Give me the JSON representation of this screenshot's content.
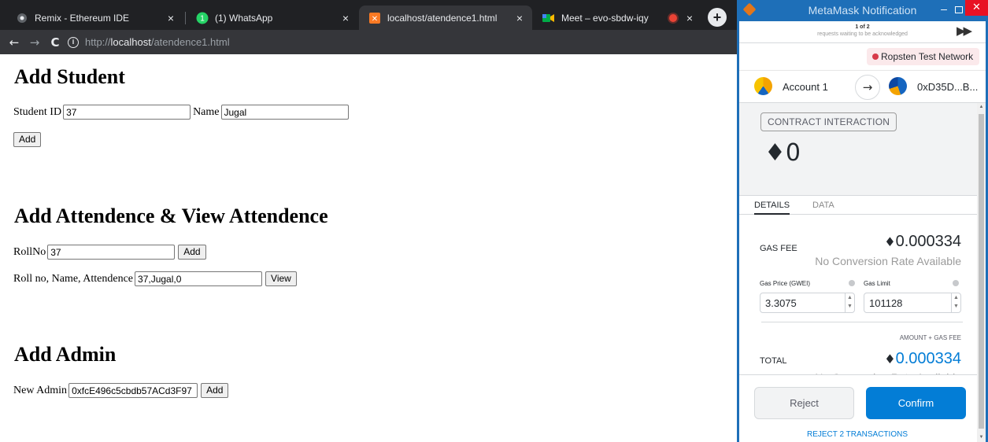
{
  "browser": {
    "tabs": [
      {
        "label": "Remix - Ethereum IDE",
        "close": "×"
      },
      {
        "label": "(1) WhatsApp",
        "close": "×"
      },
      {
        "label": "localhost/atendence1.html",
        "close": "×"
      },
      {
        "label": "Meet – evo-sbdw-iqy",
        "close": "×"
      }
    ],
    "whatsapp_badge": "1",
    "new_tab": "+",
    "url_scheme": "http://",
    "url_host": "localhost",
    "url_path": "/atendence1.html"
  },
  "page": {
    "add_student": {
      "heading": "Add Student",
      "id_label": "Student ID",
      "id_value": "37",
      "name_label": "Name",
      "name_value": "Jugal",
      "add_button": "Add"
    },
    "attendance": {
      "heading": "Add Attendence & View Attendence",
      "roll_label": "RollNo",
      "roll_value": "37",
      "add_button": "Add",
      "view_label": "Roll no, Name, Attendence",
      "view_value": "37,Jugal,0",
      "view_button": "View"
    },
    "admin": {
      "heading": "Add Admin",
      "label": "New Admin",
      "value": "0xfcE496c5cbdb57ACd3F97",
      "add_button": "Add"
    }
  },
  "metamask": {
    "window_title": "MetaMask Notification",
    "window_controls": {
      "minimize": "–",
      "close": "✕"
    },
    "queue_count": "1 of 2",
    "queue_text": "requests waiting to be acknowledged",
    "network": "Ropsten Test Network",
    "from_account": "Account 1",
    "to_account": "0xD35D...B...",
    "badge": "CONTRACT INTERACTION",
    "amount": "0",
    "tabs": [
      "DETAILS",
      "DATA"
    ],
    "gas_fee_label": "GAS FEE",
    "gas_fee_value": "0.000334",
    "no_conversion": "No Conversion Rate Available",
    "gas_price_label": "Gas Price (GWEI)",
    "gas_limit_label": "Gas Limit",
    "gas_price_value": "3.3075",
    "gas_limit_value": "101128",
    "amount_gas_label": "AMOUNT + GAS FEE",
    "total_label": "TOTAL",
    "total_value": "0.000334",
    "total_no_conversion": "No Conversion Rate Available",
    "reject_button": "Reject",
    "confirm_button": "Confirm",
    "reject_all": "REJECT 2 TRANSACTIONS",
    "colors": {
      "accent": "#037dd6",
      "network_dot": "#d73a49",
      "title_bar": "#1e6fb8"
    }
  }
}
